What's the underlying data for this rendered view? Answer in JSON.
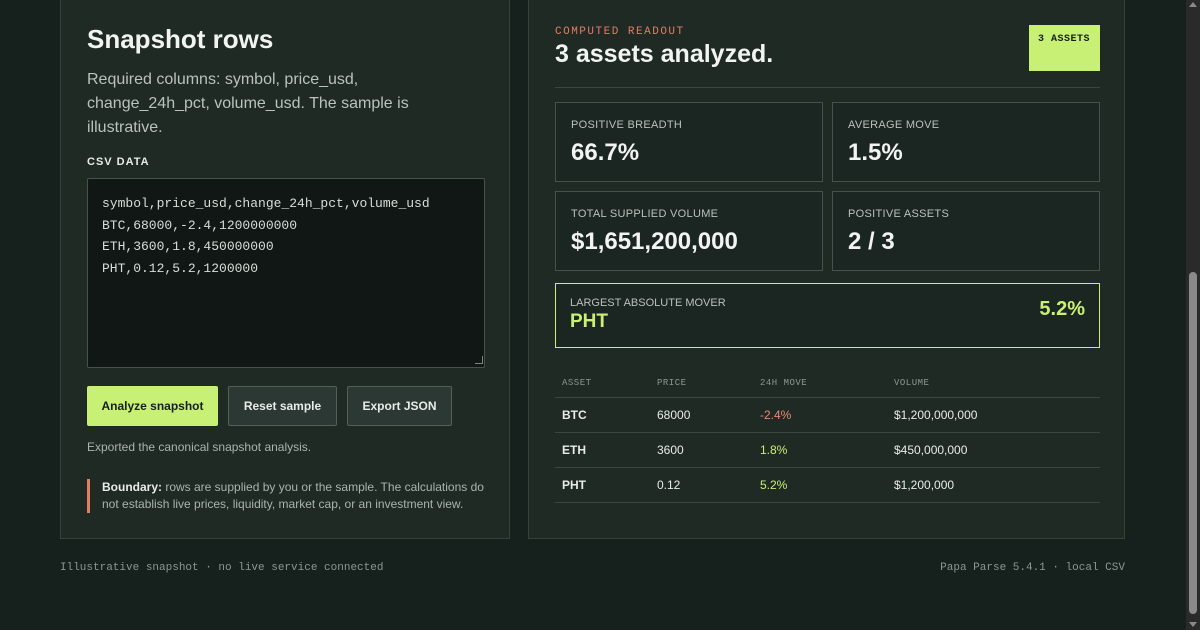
{
  "input_panel": {
    "title": "Snapshot rows",
    "description": "Required columns: symbol, price_usd, change_24h_pct, volume_usd. The sample is illustrative.",
    "csv_label": "CSV DATA",
    "csv_value": "symbol,price_usd,change_24h_pct,volume_usd\nBTC,68000,-2.4,1200000000\nETH,3600,1.8,450000000\nPHT,0.12,5.2,1200000",
    "analyze_label": "Analyze snapshot",
    "reset_label": "Reset sample",
    "export_label": "Export JSON",
    "status_text": "Exported the canonical snapshot analysis.",
    "boundary_title": "Boundary:",
    "boundary_text": " rows are supplied by you or the sample. The calculations do not establish live prices, liquidity, market cap, or an investment view."
  },
  "readout": {
    "eyebrow": "COMPUTED READOUT",
    "headline": "3 assets analyzed.",
    "badge": "3 ASSETS",
    "cards": [
      {
        "label": "POSITIVE BREADTH",
        "value": "66.7%"
      },
      {
        "label": "AVERAGE MOVE",
        "value": "1.5%"
      },
      {
        "label": "TOTAL SUPPLIED VOLUME",
        "value": "$1,651,200,000"
      },
      {
        "label": "POSITIVE ASSETS",
        "value": "2 / 3"
      }
    ],
    "mover": {
      "label": "LARGEST ABSOLUTE MOVER",
      "symbol": "PHT",
      "value": "5.2%"
    },
    "table": {
      "headers": [
        "ASSET",
        "PRICE",
        "24H MOVE",
        "VOLUME"
      ],
      "rows": [
        {
          "asset": "BTC",
          "price": "68000",
          "move": "-2.4%",
          "volume": "$1,200,000,000"
        },
        {
          "asset": "ETH",
          "price": "3600",
          "move": "1.8%",
          "volume": "$450,000,000"
        },
        {
          "asset": "PHT",
          "price": "0.12",
          "move": "5.2%",
          "volume": "$1,200,000"
        }
      ]
    }
  },
  "footer": {
    "left": "Illustrative snapshot · no live service connected",
    "right": "Papa Parse 5.4.1 · local CSV"
  },
  "colors": {
    "accent": "#c8f075",
    "negative": "#e88a70",
    "eyebrow": "#e07d63",
    "background": "#16201c"
  }
}
